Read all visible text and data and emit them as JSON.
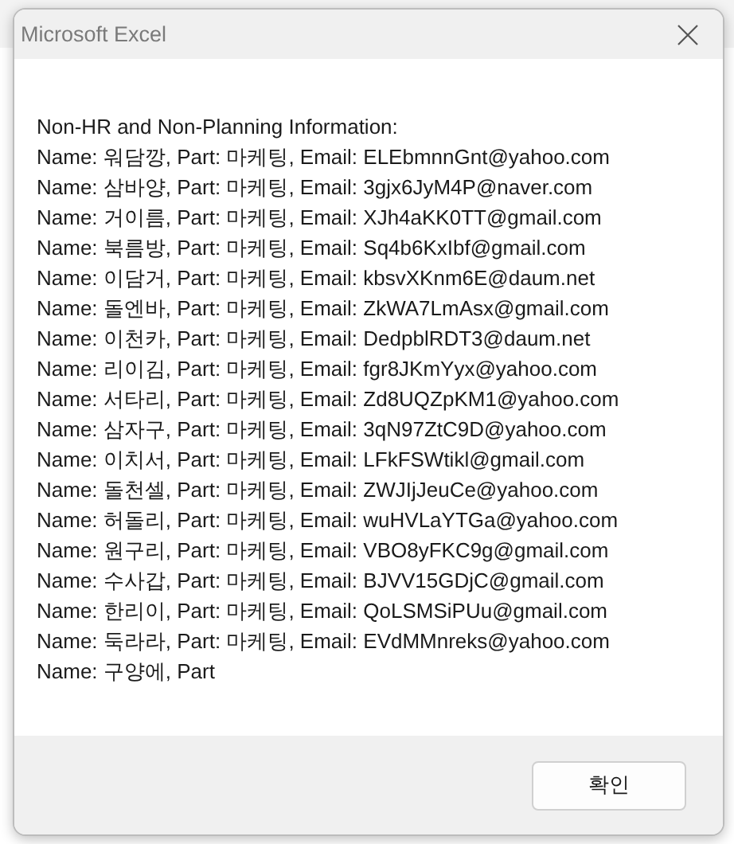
{
  "window": {
    "title": "Microsoft Excel"
  },
  "message": {
    "heading": "Non-HR and Non-Planning Information:",
    "lines": [
      "Name: 워담깡, Part: 마케팅, Email: ELEbmnnGnt@yahoo.com",
      "Name: 삼바양, Part: 마케팅, Email: 3gjx6JyM4P@naver.com",
      "Name: 거이름, Part: 마케팅, Email: XJh4aKK0TT@gmail.com",
      "Name: 북름방, Part: 마케팅, Email: Sq4b6KxIbf@gmail.com",
      "Name: 이담거, Part: 마케팅, Email: kbsvXKnm6E@daum.net",
      "Name: 돌엔바, Part: 마케팅, Email: ZkWA7LmAsx@gmail.com",
      "Name: 이천카, Part: 마케팅, Email: DedpblRDT3@daum.net",
      "Name: 리이김, Part: 마케팅, Email: fgr8JKmYyx@yahoo.com",
      "Name: 서타리, Part: 마케팅, Email: Zd8UQZpKM1@yahoo.com",
      "Name: 삼자구, Part: 마케팅, Email: 3qN97ZtC9D@yahoo.com",
      "Name: 이치서, Part: 마케팅, Email: LFkFSWtikl@gmail.com",
      "Name: 돌천셀, Part: 마케팅, Email: ZWJIjJeuCe@yahoo.com",
      "Name: 허돌리, Part: 마케팅, Email: wuHVLaYTGa@yahoo.com",
      "Name: 원구리, Part: 마케팅, Email: VBO8yFKC9g@gmail.com",
      "Name: 수사갑, Part: 마케팅, Email: BJVV15GDjC@gmail.com",
      "Name: 한리이, Part: 마케팅, Email: QoLSMSiPUu@gmail.com",
      "Name: 둑라라, Part: 마케팅, Email: EVdMMnreks@yahoo.com",
      "Name: 구양에, Part"
    ]
  },
  "buttons": [
    {
      "label": "확인"
    }
  ]
}
